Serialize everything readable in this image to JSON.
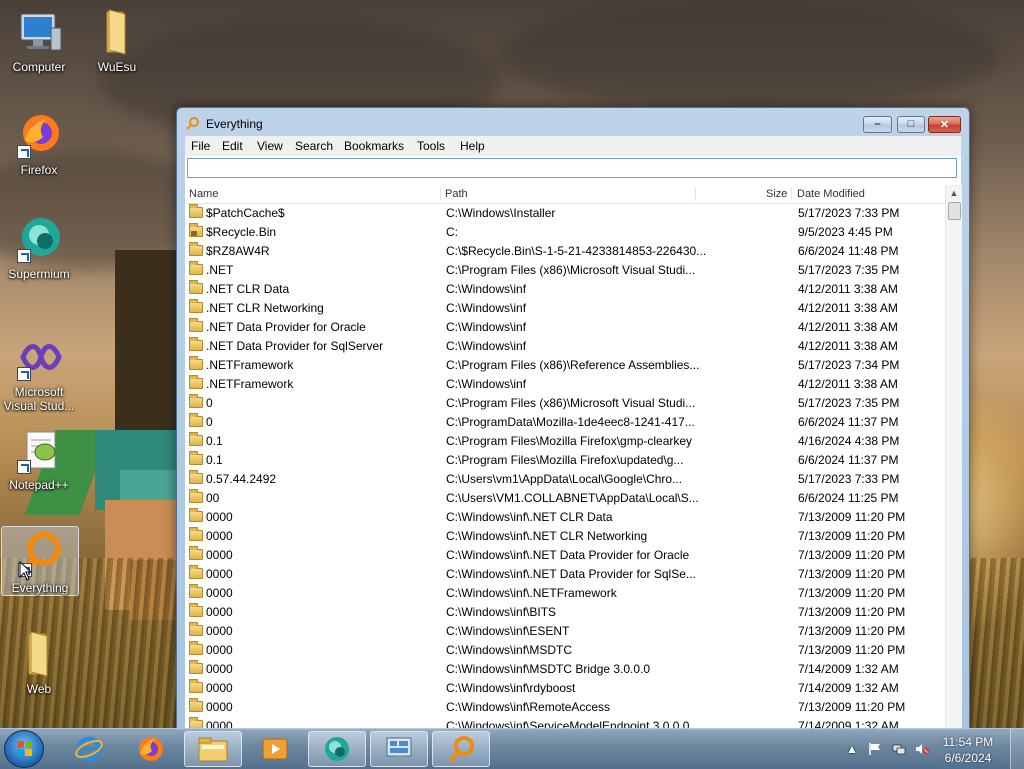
{
  "desktop": {
    "icons": [
      {
        "label": "Computer",
        "icon": "computer-icon"
      },
      {
        "label": "WuEsu",
        "icon": "folder-icon"
      },
      {
        "label": "Firefox",
        "icon": "firefox-icon"
      },
      {
        "label": "Supermium",
        "icon": "supermium-icon"
      },
      {
        "label": "Microsoft Visual Stud...",
        "icon": "visual-studio-icon"
      },
      {
        "label": "Notepad++",
        "icon": "notepadpp-icon"
      },
      {
        "label": "Everything",
        "icon": "everything-icon"
      },
      {
        "label": "Web",
        "icon": "folder-icon"
      }
    ]
  },
  "window": {
    "title": "Everything",
    "menu": [
      "File",
      "Edit",
      "View",
      "Search",
      "Bookmarks",
      "Tools",
      "Help"
    ],
    "search": {
      "value": "",
      "placeholder": ""
    },
    "columns": {
      "name": "Name",
      "path": "Path",
      "size": "Size",
      "date": "Date Modified"
    },
    "rows": [
      {
        "name": "$PatchCache$",
        "path": "C:\\Windows\\Installer",
        "date": "5/17/2023 7:33 PM",
        "locked": false
      },
      {
        "name": "$Recycle.Bin",
        "path": "C:",
        "date": "9/5/2023 4:45 PM",
        "locked": true
      },
      {
        "name": "$RZ8AW4R",
        "path": "C:\\$Recycle.Bin\\S-1-5-21-4233814853-226430...",
        "date": "6/6/2024 11:48 PM",
        "locked": false
      },
      {
        "name": ".NET",
        "path": "C:\\Program Files (x86)\\Microsoft Visual Studi...",
        "date": "5/17/2023 7:35 PM",
        "locked": false
      },
      {
        "name": ".NET CLR Data",
        "path": "C:\\Windows\\inf",
        "date": "4/12/2011 3:38 AM",
        "locked": false
      },
      {
        "name": ".NET CLR Networking",
        "path": "C:\\Windows\\inf",
        "date": "4/12/2011 3:38 AM",
        "locked": false
      },
      {
        "name": ".NET Data Provider for Oracle",
        "path": "C:\\Windows\\inf",
        "date": "4/12/2011 3:38 AM",
        "locked": false
      },
      {
        "name": ".NET Data Provider for SqlServer",
        "path": "C:\\Windows\\inf",
        "date": "4/12/2011 3:38 AM",
        "locked": false
      },
      {
        "name": ".NETFramework",
        "path": "C:\\Program Files (x86)\\Reference Assemblies...",
        "date": "5/17/2023 7:34 PM",
        "locked": false
      },
      {
        "name": ".NETFramework",
        "path": "C:\\Windows\\inf",
        "date": "4/12/2011 3:38 AM",
        "locked": false
      },
      {
        "name": "0",
        "path": "C:\\Program Files (x86)\\Microsoft Visual Studi...",
        "date": "5/17/2023 7:35 PM",
        "locked": false
      },
      {
        "name": "0",
        "path": "C:\\ProgramData\\Mozilla-1de4eec8-1241-417...",
        "date": "6/6/2024 11:37 PM",
        "locked": false
      },
      {
        "name": "0.1",
        "path": "C:\\Program Files\\Mozilla Firefox\\gmp-clearkey",
        "date": "4/16/2024 4:38 PM",
        "locked": false
      },
      {
        "name": "0.1",
        "path": "C:\\Program Files\\Mozilla Firefox\\updated\\g...",
        "date": "6/6/2024 11:37 PM",
        "locked": false
      },
      {
        "name": "0.57.44.2492",
        "path": "C:\\Users\\vm1\\AppData\\Local\\Google\\Chro...",
        "date": "5/17/2023 7:33 PM",
        "locked": false
      },
      {
        "name": "00",
        "path": "C:\\Users\\VM1.COLLABNET\\AppData\\Local\\S...",
        "date": "6/6/2024 11:25 PM",
        "locked": false
      },
      {
        "name": "0000",
        "path": "C:\\Windows\\inf\\.NET CLR Data",
        "date": "7/13/2009 11:20 PM",
        "locked": false
      },
      {
        "name": "0000",
        "path": "C:\\Windows\\inf\\.NET CLR Networking",
        "date": "7/13/2009 11:20 PM",
        "locked": false
      },
      {
        "name": "0000",
        "path": "C:\\Windows\\inf\\.NET Data Provider for Oracle",
        "date": "7/13/2009 11:20 PM",
        "locked": false
      },
      {
        "name": "0000",
        "path": "C:\\Windows\\inf\\.NET Data Provider for SqlSe...",
        "date": "7/13/2009 11:20 PM",
        "locked": false
      },
      {
        "name": "0000",
        "path": "C:\\Windows\\inf\\.NETFramework",
        "date": "7/13/2009 11:20 PM",
        "locked": false
      },
      {
        "name": "0000",
        "path": "C:\\Windows\\inf\\BITS",
        "date": "7/13/2009 11:20 PM",
        "locked": false
      },
      {
        "name": "0000",
        "path": "C:\\Windows\\inf\\ESENT",
        "date": "7/13/2009 11:20 PM",
        "locked": false
      },
      {
        "name": "0000",
        "path": "C:\\Windows\\inf\\MSDTC",
        "date": "7/13/2009 11:20 PM",
        "locked": false
      },
      {
        "name": "0000",
        "path": "C:\\Windows\\inf\\MSDTC Bridge 3.0.0.0",
        "date": "7/14/2009 1:32 AM",
        "locked": false
      },
      {
        "name": "0000",
        "path": "C:\\Windows\\inf\\rdyboost",
        "date": "7/14/2009 1:32 AM",
        "locked": false
      },
      {
        "name": "0000",
        "path": "C:\\Windows\\inf\\RemoteAccess",
        "date": "7/13/2009 11:20 PM",
        "locked": false
      },
      {
        "name": "0000",
        "path": "C:\\Windows\\inf\\ServiceModelEndpoint 3.0.0.0",
        "date": "7/14/2009 1:32 AM",
        "locked": false
      }
    ]
  },
  "taskbar": {
    "items": [
      {
        "icon": "internet-explorer-icon",
        "active": false
      },
      {
        "icon": "firefox-icon",
        "active": false
      },
      {
        "icon": "file-explorer-icon",
        "active": true
      },
      {
        "icon": "media-player-icon",
        "active": false
      },
      {
        "icon": "supermium-icon",
        "active": true
      },
      {
        "icon": "control-panel-icon",
        "active": true
      },
      {
        "icon": "everything-icon",
        "active": true
      }
    ],
    "tray": [
      "show-hidden-icons",
      "action-center-flag-icon",
      "network-icon",
      "volume-muted-icon"
    ],
    "clock": {
      "time": "11:54 PM",
      "date": "6/6/2024"
    }
  }
}
